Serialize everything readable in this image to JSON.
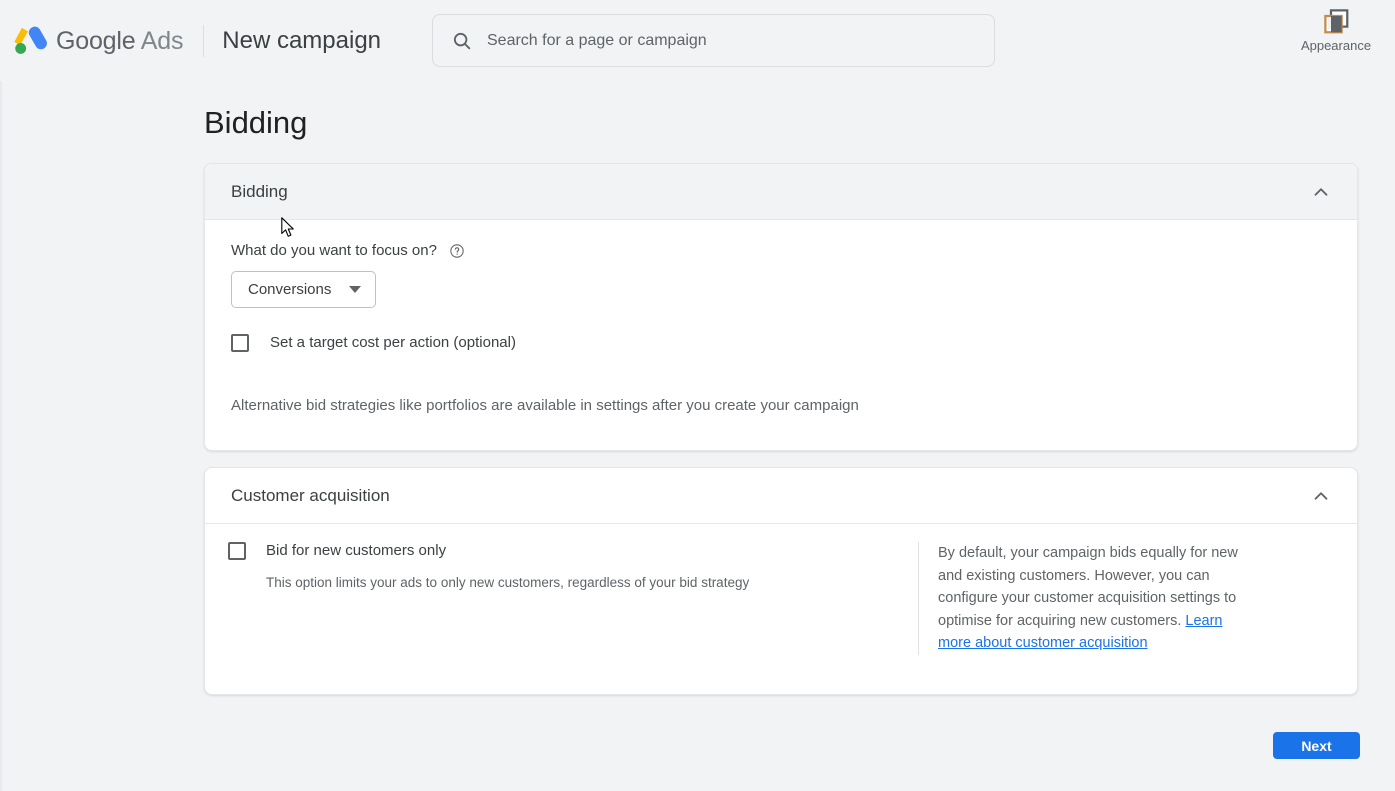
{
  "topbar": {
    "logo_icon": "google-ads-logo",
    "brand_google": "Google",
    "brand_ads": "Ads",
    "page_chip": "New campaign",
    "search": {
      "icon": "search-icon",
      "placeholder": "Search for a page or campaign",
      "value": ""
    },
    "appearance": {
      "icon": "appearance-icon",
      "label": "Appearance"
    }
  },
  "page": {
    "title": "Bidding"
  },
  "cards": {
    "bidding": {
      "title": "Bidding",
      "collapse_icon": "chevron-up-icon",
      "focus_label": "What do you want to focus on?",
      "help_icon": "help-circle-icon",
      "focus_select_value": "Conversions",
      "focus_select_caret": "caret-down-icon",
      "target_cpa_checkbox_label": "Set a target cost per action (optional)",
      "target_cpa_checked": false,
      "note": "Alternative bid strategies like portfolios are available in settings after you create your campaign"
    },
    "customer_acquisition": {
      "title": "Customer acquisition",
      "collapse_icon": "chevron-up-icon",
      "bid_new_checkbox_label": "Bid for new customers only",
      "bid_new_checked": false,
      "bid_new_sublabel": "This option limits your ads to only new customers, regardless of your bid strategy",
      "info_text": "By default, your campaign bids equally for new and existing customers. However, you can configure your customer acquisition settings to optimise for acquiring new customers. ",
      "info_link": "Learn more about customer acquisition"
    }
  },
  "footer": {
    "next_label": "Next"
  },
  "colors": {
    "accent": "#1a73e8",
    "page_bg": "#f1f3f4",
    "card_bg": "#ffffff",
    "text_primary": "#3c4043",
    "text_secondary": "#5f6368",
    "logo_yellow": "#fbbc04",
    "logo_blue": "#4285f4",
    "logo_green": "#34a853"
  }
}
